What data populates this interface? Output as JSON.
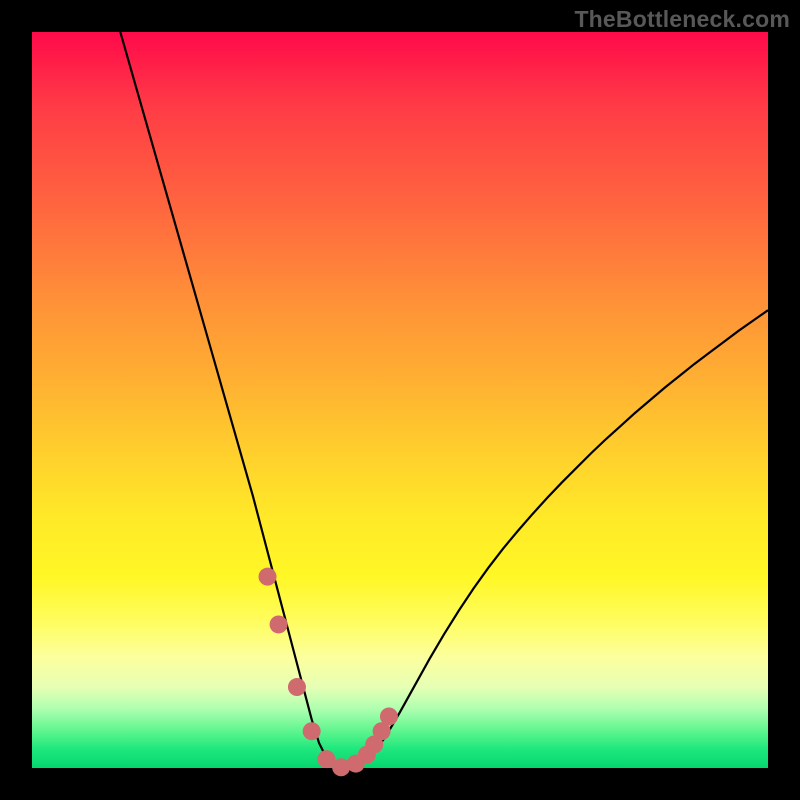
{
  "watermark": "TheBottleneck.com",
  "chart_data": {
    "type": "line",
    "title": "",
    "xlabel": "",
    "ylabel": "",
    "xlim": [
      0,
      100
    ],
    "ylim": [
      0,
      100
    ],
    "series": [
      {
        "name": "curve",
        "color": "#000000",
        "x": [
          12,
          14,
          16,
          18,
          20,
          22,
          24,
          26,
          28,
          30,
          31,
          32,
          33,
          34,
          35,
          36,
          37,
          38,
          39,
          40,
          41,
          42,
          43,
          44,
          46,
          48,
          50,
          52,
          54,
          56,
          58,
          60,
          62,
          64,
          66,
          68,
          70,
          72,
          74,
          76,
          78,
          80,
          82,
          84,
          86,
          88,
          90,
          92,
          94,
          96,
          98,
          100
        ],
        "y": [
          100,
          93,
          86,
          79,
          72,
          65,
          58,
          51,
          44,
          37,
          33.2,
          29.4,
          25.6,
          21.8,
          18,
          14.2,
          10.4,
          6.6,
          3.4,
          1.4,
          0.3,
          0,
          0,
          0.3,
          1.6,
          4.2,
          7.6,
          11.2,
          14.8,
          18.2,
          21.4,
          24.4,
          27.2,
          29.8,
          32.2,
          34.5,
          36.7,
          38.8,
          40.8,
          42.8,
          44.7,
          46.5,
          48.3,
          50,
          51.7,
          53.3,
          54.9,
          56.4,
          57.9,
          59.4,
          60.8,
          62.2
        ]
      }
    ],
    "markers": {
      "name": "highlight-dots",
      "color": "#cf6a6f",
      "x": [
        32,
        33.5,
        36,
        38,
        40,
        42,
        44,
        45.5,
        46.5,
        47.5,
        48.5
      ],
      "y": [
        26,
        19.5,
        11,
        5,
        1.2,
        0.1,
        0.6,
        1.8,
        3.2,
        5.0,
        7.0
      ]
    }
  },
  "colors": {
    "curve": "#000000",
    "markers": "#cf6a6f",
    "frame": "#000000"
  }
}
